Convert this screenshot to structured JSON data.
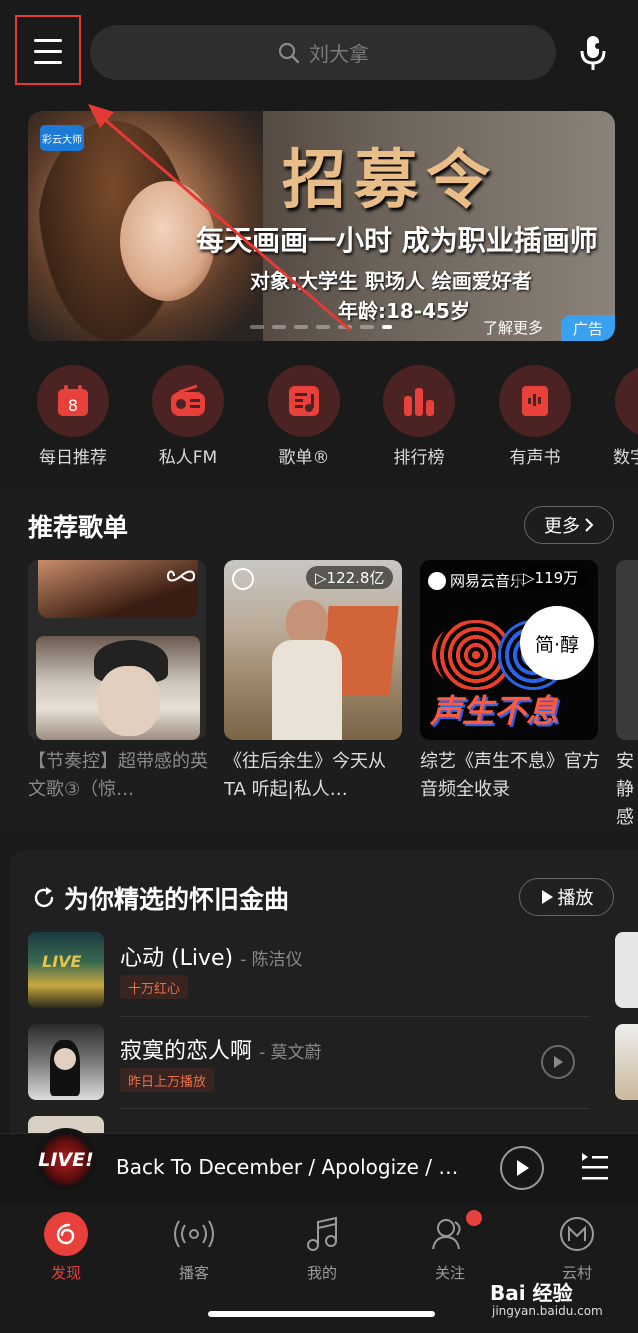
{
  "search": {
    "placeholder": "刘大拿"
  },
  "banner": {
    "logo_text": "彩云大师",
    "title": "招募令",
    "subtitle": "每天画画一小时 成为职业插画师",
    "line3": "对象:大学生 职场人 绘画爱好者",
    "line4": "年龄:18-45岁",
    "more": "了解更多",
    "tag": "广告"
  },
  "quick_entries": [
    {
      "label": "每日推荐",
      "icon": "calendar-icon",
      "day": "8"
    },
    {
      "label": "私人FM",
      "icon": "radio-icon"
    },
    {
      "label": "歌单®",
      "icon": "playlist-icon"
    },
    {
      "label": "排行榜",
      "icon": "chart-bars-icon"
    },
    {
      "label": "有声书",
      "icon": "book-icon"
    },
    {
      "label": "数字",
      "icon": "album-icon"
    }
  ],
  "recommend": {
    "title": "推荐歌单",
    "more": "更多",
    "cards": [
      {
        "caption": "【节奏控】超带感的英文歌③（惊…"
      },
      {
        "caption": "《往后余生》今天从TA 听起|私人…",
        "plays": "▷122.8亿"
      },
      {
        "caption": "综艺《声生不息》官方音频全收录",
        "plays": "▷119万",
        "brand": "网易云音乐",
        "cover_text": "声生不息",
        "cover_text2": "简·醇"
      },
      {
        "caption": "安静感"
      }
    ]
  },
  "golden": {
    "title": "为你精选的怀旧金曲",
    "play": "播放",
    "songs": [
      {
        "title": "心动 (Live)",
        "artist": "- 陈洁仪",
        "tag": "十万红心"
      },
      {
        "title": "寂寞的恋人啊",
        "artist": "- 莫文蔚",
        "tag": "昨日上万播放"
      }
    ]
  },
  "player": {
    "now_playing": "Back To December / Apologize / …",
    "disc_text": "LIVE!"
  },
  "tabs": [
    {
      "label": "发现",
      "icon": "netease-logo-icon",
      "active": true
    },
    {
      "label": "播客",
      "icon": "podcast-icon"
    },
    {
      "label": "我的",
      "icon": "music-note-icon"
    },
    {
      "label": "关注",
      "icon": "follow-icon",
      "dot": true
    },
    {
      "label": "云村",
      "icon": "cloud-village-icon"
    }
  ],
  "watermark": {
    "line1": "Bai 经验",
    "line2": "jingyan.baidu.com"
  },
  "colors": {
    "accent": "#e8403a",
    "badge_blue": "#3aa0f0",
    "highlight_box": "#e53935"
  }
}
